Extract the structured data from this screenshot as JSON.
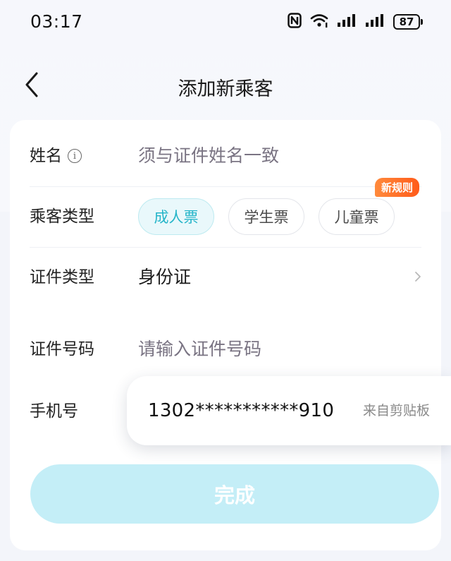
{
  "status_bar": {
    "time": "03:17",
    "battery": "87",
    "icons": [
      "nfc-icon",
      "wifi-icon",
      "signal-icon",
      "signal-icon",
      "battery-icon"
    ]
  },
  "nav": {
    "title": "添加新乘客"
  },
  "form": {
    "name": {
      "label": "姓名",
      "placeholder": "须与证件姓名一致"
    },
    "passenger_type": {
      "label": "乘客类型",
      "options": [
        "成人票",
        "学生票",
        "儿童票"
      ],
      "selected": "成人票",
      "badge": "新规则"
    },
    "id_type": {
      "label": "证件类型",
      "value": "身份证"
    },
    "id_number": {
      "label": "证件号码",
      "placeholder": "请输入证件号码"
    },
    "phone": {
      "label": "手机号"
    }
  },
  "clipboard_suggestion": {
    "value": "1302***********910",
    "source": "来自剪贴板"
  },
  "submit": {
    "label": "完成"
  },
  "colors": {
    "accent": "#25b5c9",
    "submit_bg": "#c4eef7",
    "badge": "#ff6a26"
  }
}
